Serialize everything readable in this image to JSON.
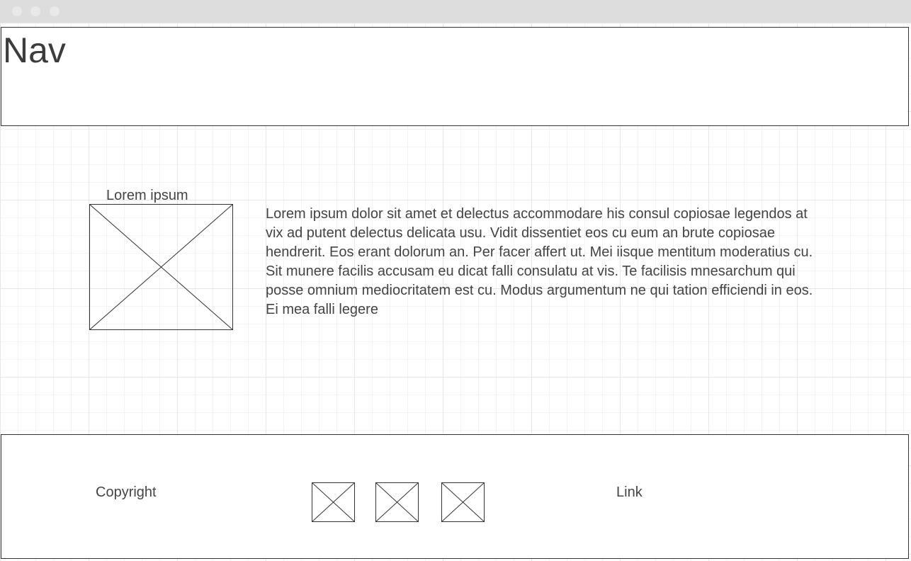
{
  "nav": {
    "title": "Nav"
  },
  "content": {
    "image_label": "Lorem ipsum",
    "paragraph": "Lorem ipsum dolor sit amet et delectus accommodare his consul copiosae legendos at vix ad putent delectus delicata usu. Vidit dissentiet eos cu eum an brute copiosae hendrerit. Eos erant dolorum an. Per facer affert ut. Mei iisque mentitum moderatius cu. Sit munere facilis accusam eu dicat falli consulatu at vis. Te facilisis mnesarchum qui posse omnium mediocritatem est cu. Modus argumentum ne qui tation efficiendi in eos. Ei mea falli legere"
  },
  "footer": {
    "copyright": "Copyright",
    "link": "Link"
  }
}
